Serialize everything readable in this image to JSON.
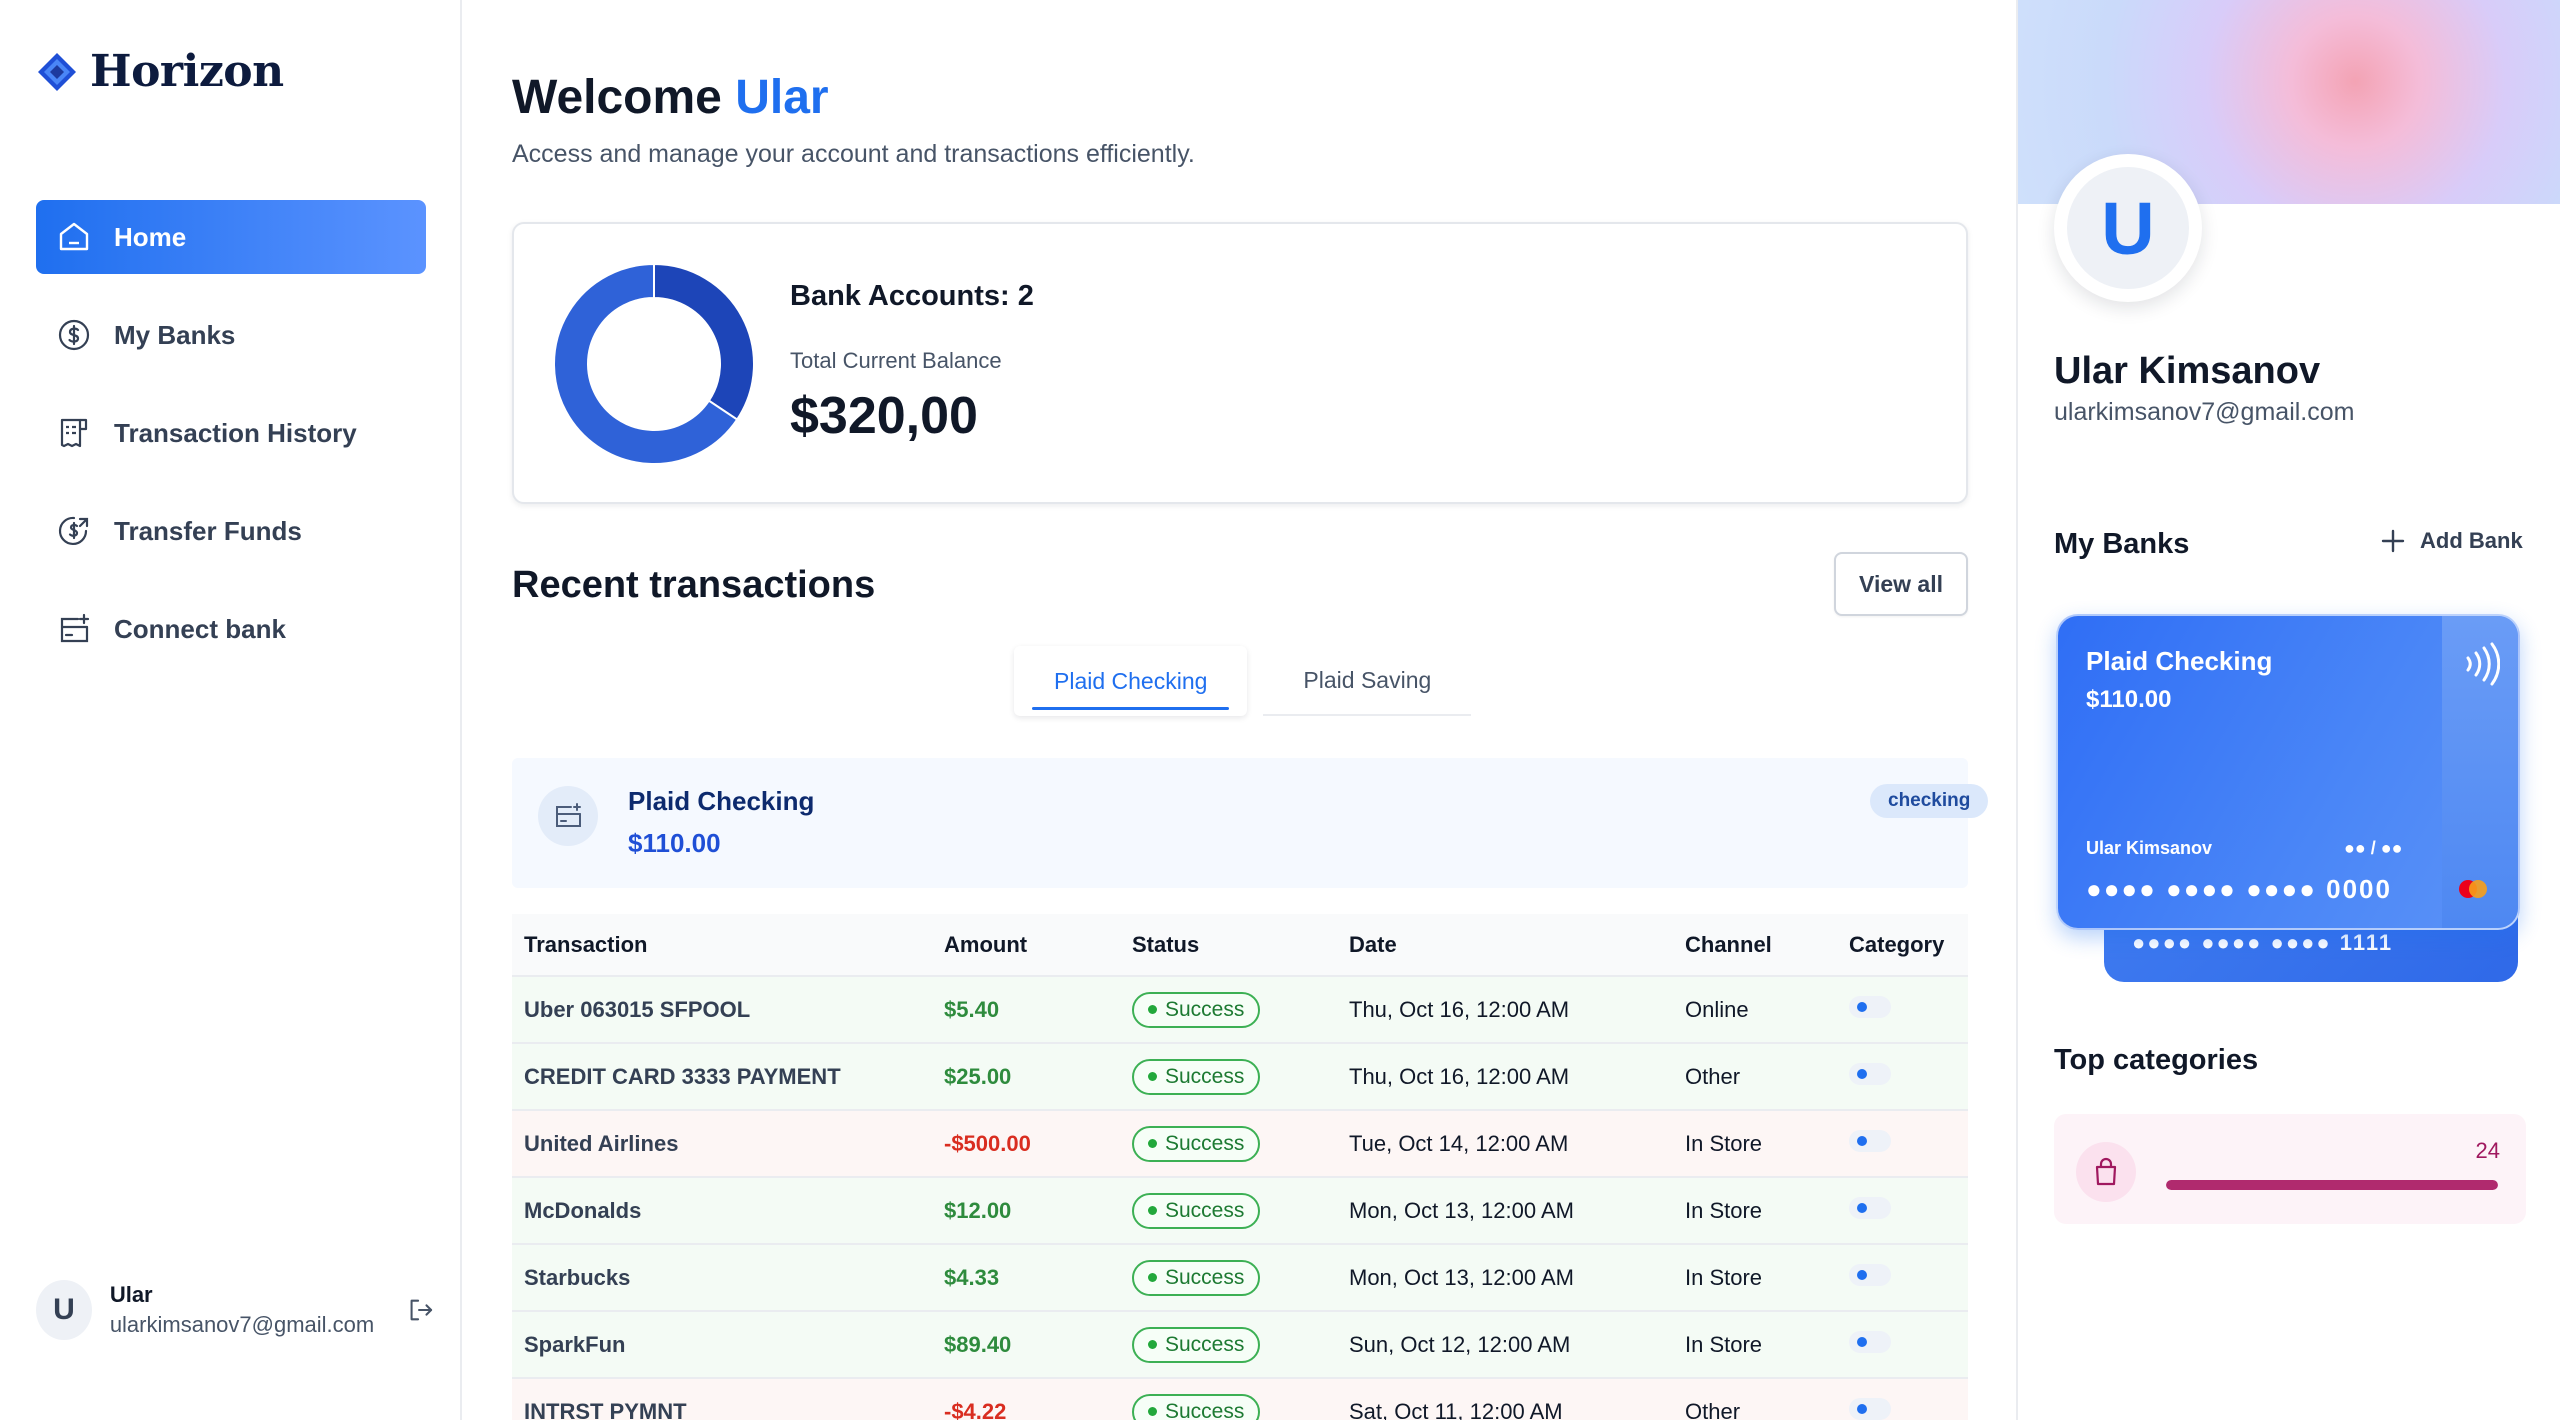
{
  "app": {
    "name": "Horizon"
  },
  "nav": {
    "items": [
      {
        "label": "Home",
        "icon": "home-icon",
        "active": true
      },
      {
        "label": "My Banks",
        "icon": "dollar-circle-icon"
      },
      {
        "label": "Transaction History",
        "icon": "receipt-icon"
      },
      {
        "label": "Transfer Funds",
        "icon": "money-send-icon"
      },
      {
        "label": "Connect bank",
        "icon": "connect-bank-icon"
      }
    ]
  },
  "sidebar_user": {
    "initial": "U",
    "name": "Ular",
    "email": "ularkimsanov7@gmail.com"
  },
  "header": {
    "welcome_prefix": "Welcome",
    "welcome_name": "Ular",
    "subtitle": "Access and manage your account and transactions efficiently."
  },
  "balance": {
    "accounts_label": "Bank Accounts: 2",
    "total_label": "Total Current Balance",
    "total_value": "$320,00",
    "donut_shares": [
      0.34375,
      0.65625
    ],
    "donut_colors": [
      "#1d45b8",
      "#2f62d8"
    ]
  },
  "recent": {
    "title": "Recent transactions",
    "view_all": "View all",
    "tabs": [
      "Plaid Checking",
      "Plaid Saving"
    ],
    "account": {
      "name": "Plaid Checking",
      "balance": "$110.00",
      "type": "checking"
    },
    "columns": [
      "Transaction",
      "Amount",
      "Status",
      "Date",
      "Channel",
      "Category"
    ],
    "rows": [
      {
        "name": "Uber 063015 SFPOOL",
        "amount": "$5.40",
        "sign": "pos",
        "status": "Success",
        "date": "Thu, Oct 16, 12:00 AM",
        "channel": "Online"
      },
      {
        "name": "CREDIT CARD 3333 PAYMENT",
        "amount": "$25.00",
        "sign": "pos",
        "status": "Success",
        "date": "Thu, Oct 16, 12:00 AM",
        "channel": "Other"
      },
      {
        "name": "United Airlines",
        "amount": "-$500.00",
        "sign": "neg",
        "status": "Success",
        "date": "Tue, Oct 14, 12:00 AM",
        "channel": "In Store"
      },
      {
        "name": "McDonalds",
        "amount": "$12.00",
        "sign": "pos",
        "status": "Success",
        "date": "Mon, Oct 13, 12:00 AM",
        "channel": "In Store"
      },
      {
        "name": "Starbucks",
        "amount": "$4.33",
        "sign": "pos",
        "status": "Success",
        "date": "Mon, Oct 13, 12:00 AM",
        "channel": "In Store"
      },
      {
        "name": "SparkFun",
        "amount": "$89.40",
        "sign": "pos",
        "status": "Success",
        "date": "Sun, Oct 12, 12:00 AM",
        "channel": "In Store"
      },
      {
        "name": "INTRST PYMNT",
        "amount": "-$4.22",
        "sign": "neg",
        "status": "Success",
        "date": "Sat, Oct 11, 12:00 AM",
        "channel": "Other"
      }
    ]
  },
  "profile": {
    "initial": "U",
    "name": "Ular Kimsanov",
    "email": "ularkimsanov7@gmail.com"
  },
  "my_banks": {
    "title": "My Banks",
    "add_label": "Add Bank",
    "card": {
      "bank": "Plaid Checking",
      "balance": "$110.00",
      "holder": "Ular Kimsanov",
      "expiry": "●● / ●●",
      "number": "●●●● ●●●● ●●●● 0000"
    },
    "back_card_number": "●●●● ●●●● ●●●● 1111"
  },
  "top_categories": {
    "title": "Top categories",
    "items": [
      {
        "count": "24",
        "fill": 1.0,
        "icon": "shopping-bag-icon"
      }
    ]
  },
  "colors": {
    "accent": "#1f6fef",
    "positive": "#2e8b3d",
    "negative": "#d92d20",
    "category": "#b02a6e"
  }
}
